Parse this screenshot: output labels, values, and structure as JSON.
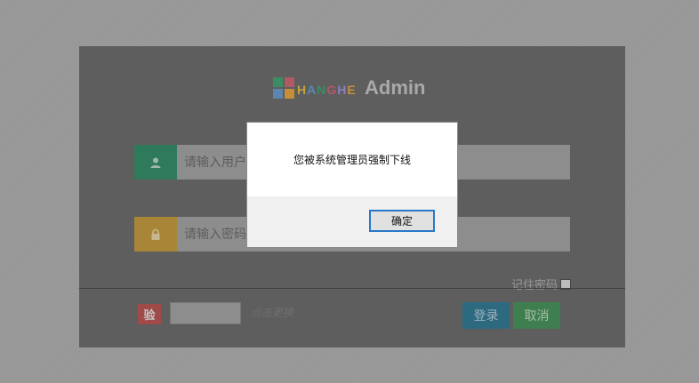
{
  "logo": {
    "brand_letters": [
      "H",
      "A",
      "N",
      "G",
      "H",
      "E"
    ],
    "brand_colors": [
      "#c2a13f",
      "#5a86b0",
      "#3b8d63",
      "#b05a66",
      "#8b7fc0",
      "#c58f3a"
    ],
    "grid_colors": [
      "#3b8d63",
      "#b05a66",
      "#5a86b0",
      "#c58f3a"
    ],
    "admin_label": "Admin"
  },
  "form": {
    "username_placeholder": "请输入用户名",
    "password_placeholder": "请输入密码",
    "remember_label": "记住密码",
    "captcha_badge": "验",
    "captcha_refresh": "点击更换",
    "login_button": "登录",
    "cancel_button": "取消"
  },
  "dialog": {
    "message": "您被系统管理员强制下线",
    "ok_button": "确定"
  }
}
